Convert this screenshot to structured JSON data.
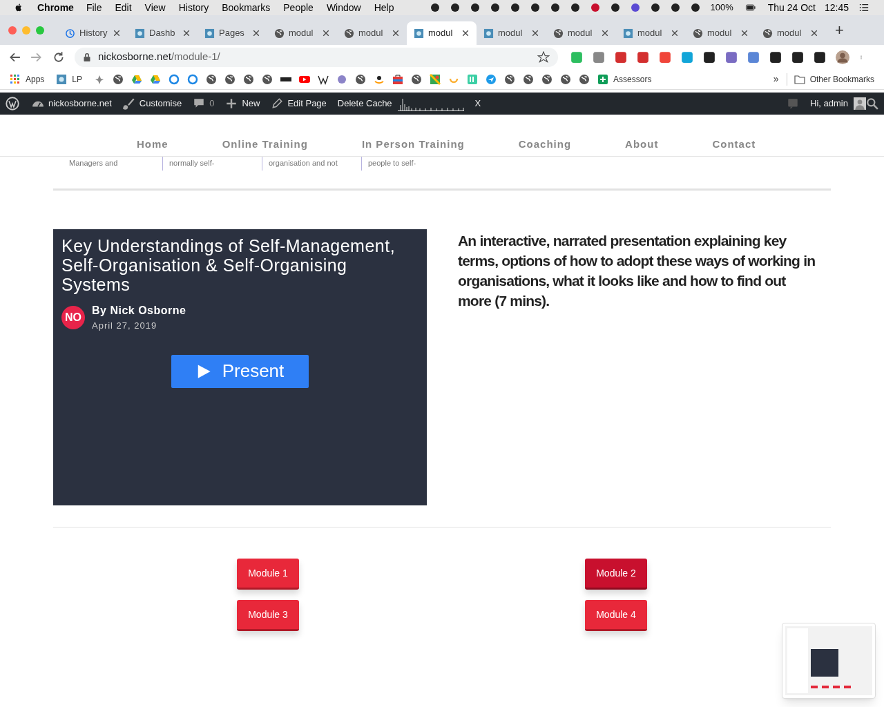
{
  "menubar": {
    "app": "Chrome",
    "menus": [
      "File",
      "Edit",
      "View",
      "History",
      "Bookmarks",
      "People",
      "Window",
      "Help"
    ],
    "battery": "100%",
    "date": "Thu 24 Oct",
    "time": "12:45"
  },
  "tabs": [
    {
      "label": "History",
      "kind": "history",
      "selected": false
    },
    {
      "label": "Dashb",
      "kind": "site",
      "selected": false
    },
    {
      "label": "Pages",
      "kind": "site",
      "selected": false
    },
    {
      "label": "modul",
      "kind": "globe",
      "selected": false
    },
    {
      "label": "modul",
      "kind": "globe",
      "selected": false
    },
    {
      "label": "modul",
      "kind": "site",
      "selected": true
    },
    {
      "label": "modul",
      "kind": "site",
      "selected": false
    },
    {
      "label": "modul",
      "kind": "globe",
      "selected": false
    },
    {
      "label": "modul",
      "kind": "site",
      "selected": false
    },
    {
      "label": "modul",
      "kind": "globe",
      "selected": false
    },
    {
      "label": "modul",
      "kind": "globe",
      "selected": false
    }
  ],
  "new_tab": "+",
  "address": {
    "host": "nickosborne.net",
    "path": "/module-1/"
  },
  "bookmarks": [
    {
      "kind": "apps",
      "label": "Apps"
    },
    {
      "kind": "site",
      "label": "LP"
    },
    {
      "kind": "bug"
    },
    {
      "kind": "globe"
    },
    {
      "kind": "drive"
    },
    {
      "kind": "drive"
    },
    {
      "kind": "ring"
    },
    {
      "kind": "ring"
    },
    {
      "kind": "globe"
    },
    {
      "kind": "globe"
    },
    {
      "kind": "globe"
    },
    {
      "kind": "globe"
    },
    {
      "kind": "bbc"
    },
    {
      "kind": "youtube"
    },
    {
      "kind": "wiki"
    },
    {
      "kind": "dot"
    },
    {
      "kind": "globe"
    },
    {
      "kind": "amazon"
    },
    {
      "kind": "bag"
    },
    {
      "kind": "globe"
    },
    {
      "kind": "maps"
    },
    {
      "kind": "smile"
    },
    {
      "kind": "tl"
    },
    {
      "kind": "plane"
    },
    {
      "kind": "globe"
    },
    {
      "kind": "globe"
    },
    {
      "kind": "globe"
    },
    {
      "kind": "globe"
    },
    {
      "kind": "globe"
    },
    {
      "kind": "sheet",
      "label": "Assessors"
    }
  ],
  "bookmarks_more": "»",
  "other_bookmarks": "Other Bookmarks",
  "admin_bar": {
    "site": "nickosborne.net",
    "customise": "Customise",
    "comments": "0",
    "new": "New",
    "edit": "Edit Page",
    "cache": "Delete Cache",
    "close": "X",
    "greeting": "Hi, admin"
  },
  "nav": [
    "Home",
    "Online Training",
    "In Person Training",
    "Coaching",
    "About",
    "Contact"
  ],
  "excerpts": [
    [
      "Managers and"
    ],
    [
      "normally self-"
    ],
    [
      "organisation and not"
    ],
    [
      "people to self-"
    ]
  ],
  "presentation": {
    "title": "Key Understandings of Self-Management, Self-Organisation & Self-Organising Systems",
    "initials": "NO",
    "author": "By Nick Osborne",
    "date": "April 27, 2019",
    "button": "Present"
  },
  "description": "An interactive, narrated presentation explaining key terms, options of how to adopt these ways of working in organisations, what it looks like and how to find out more (7 mins).",
  "modules": [
    {
      "label": "Module 1",
      "hovered": false
    },
    {
      "label": "Module 2",
      "hovered": true
    },
    {
      "label": "Module 3",
      "hovered": false
    },
    {
      "label": "Module 4",
      "hovered": false
    }
  ]
}
